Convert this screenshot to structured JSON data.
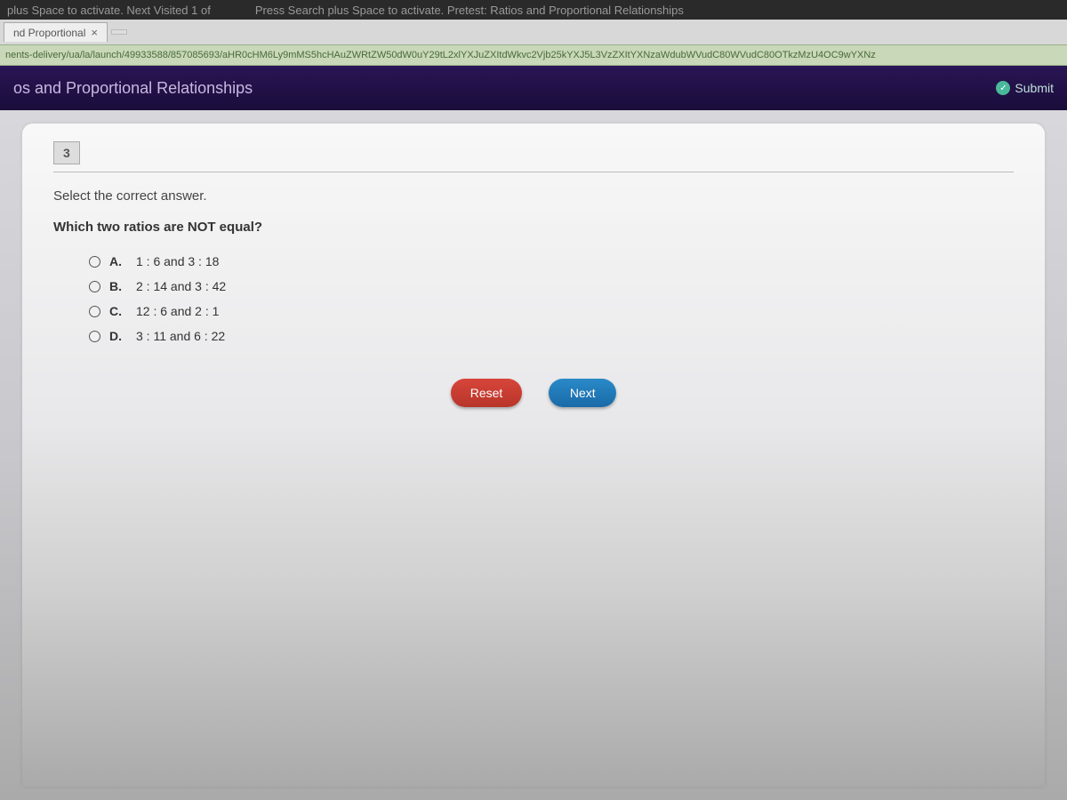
{
  "accessibility": {
    "left": "plus Space to activate. Next Visited     1 of",
    "right": "Press Search plus Space to activate. Pretest: Ratios and Proportional Relationships"
  },
  "browser": {
    "tab_title": "nd Proportional",
    "tab_close": "×",
    "new_tab": "",
    "url": "nents-delivery/ua/la/launch/49933588/857085693/aHR0cHM6Ly9mMS5hcHAuZWRtZW50dW0uY29tL2xlYXJuZXItdWkvc2Vjb25kYXJ5L3VzZXItYXNzaWdubWVudC80WVudC80OTkzMzU4OC9wYXNz"
  },
  "header": {
    "title": "os and Proportional Relationships",
    "submit": "Submit"
  },
  "quiz": {
    "number": "3",
    "instruction": "Select the correct answer.",
    "question": "Which two ratios are NOT equal?",
    "options": [
      {
        "letter": "A.",
        "text": "1 : 6 and 3 : 18"
      },
      {
        "letter": "B.",
        "text": "2 : 14 and 3 : 42"
      },
      {
        "letter": "C.",
        "text": "12 : 6 and 2 : 1"
      },
      {
        "letter": "D.",
        "text": "3 : 11 and 6 : 22"
      }
    ],
    "reset": "Reset",
    "next": "Next"
  }
}
